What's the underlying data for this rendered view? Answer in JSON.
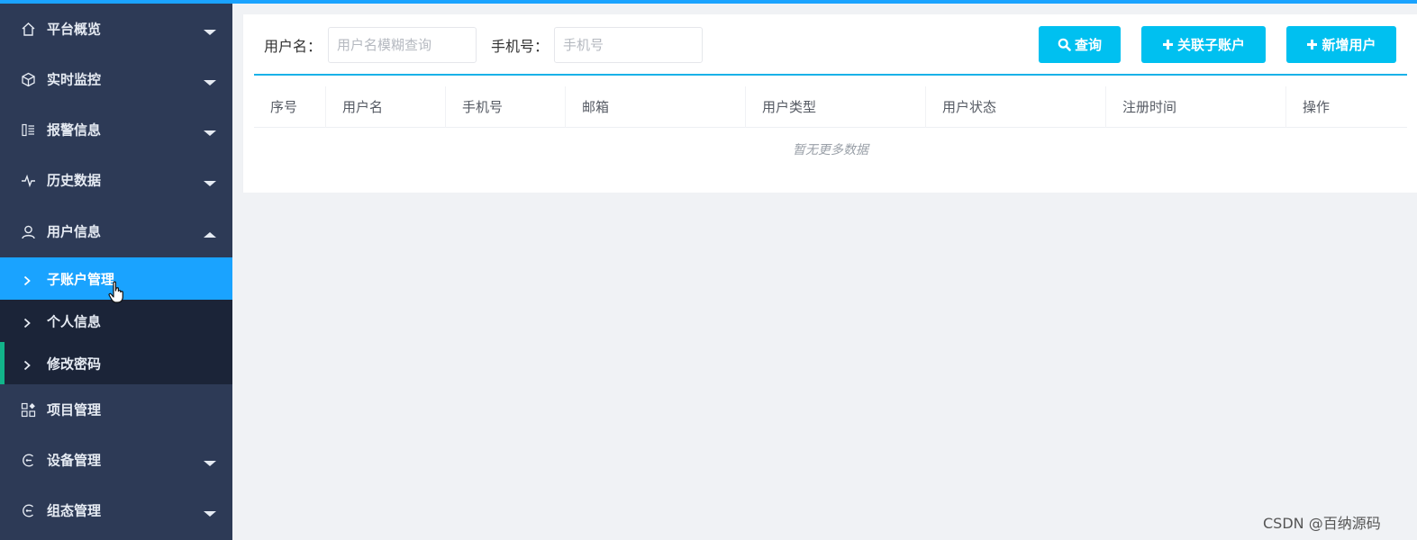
{
  "sidebar": {
    "items": [
      {
        "label": "平台概览",
        "icon": "home-icon",
        "expanded": false
      },
      {
        "label": "实时监控",
        "icon": "cube-icon",
        "expanded": false
      },
      {
        "label": "报警信息",
        "icon": "alarm-list-icon",
        "expanded": false
      },
      {
        "label": "历史数据",
        "icon": "pulse-icon",
        "expanded": false
      },
      {
        "label": "用户信息",
        "icon": "user-icon",
        "expanded": true
      },
      {
        "label": "项目管理",
        "icon": "grid-icon"
      },
      {
        "label": "设备管理",
        "icon": "device-icon",
        "expanded": false
      },
      {
        "label": "组态管理",
        "icon": "config-icon",
        "expanded": false
      }
    ],
    "submenu": [
      {
        "label": "子账户管理",
        "active": true
      },
      {
        "label": "个人信息",
        "active": false
      },
      {
        "label": "修改密码",
        "active": false
      }
    ]
  },
  "search": {
    "username_label": "用户名：",
    "username_placeholder": "用户名模糊查询",
    "phone_label": "手机号：",
    "phone_placeholder": "手机号",
    "query_button": "查询",
    "link_subaccount_button": "关联子账户",
    "add_user_button": "新增用户"
  },
  "table": {
    "columns": [
      "序号",
      "用户名",
      "手机号",
      "邮箱",
      "用户类型",
      "用户状态",
      "注册时间",
      "操作"
    ],
    "empty_text": "暂无更多数据"
  },
  "watermark": "CSDN @百纳源码",
  "colors": {
    "sidebar_bg": "#2d3a56",
    "submenu_bg": "#1b2438",
    "active_item": "#1aa3ff",
    "button": "#00c0f0",
    "accent_bar": "#12b48a"
  }
}
